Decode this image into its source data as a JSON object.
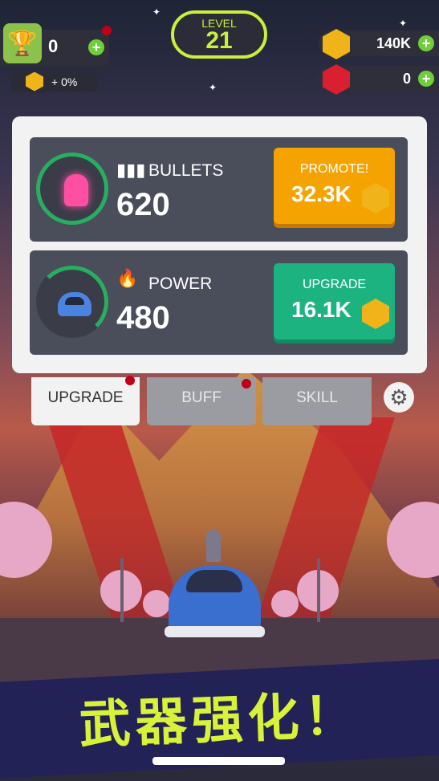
{
  "hud": {
    "trophy_count": "0",
    "bonus_text": "+ 0%",
    "level_label": "LEVEL",
    "level_number": "21",
    "gold_amount": "140K",
    "gem_amount": "0"
  },
  "upgrades": [
    {
      "icon": "bullet-icon",
      "label": "BULLETS",
      "value": "620",
      "button_label": "PROMOTE!",
      "button_price": "32.3K",
      "button_color": "#f5a300"
    },
    {
      "icon": "flame-icon",
      "label": "POWER",
      "value": "480",
      "button_label": "UPGRADE",
      "button_price": "16.1K",
      "button_color": "#1db380"
    }
  ],
  "tabs": [
    "UPGRADE",
    "BUFF",
    "SKILL"
  ],
  "banner_text": "武器强化！",
  "colors": {
    "accent": "#c8f03c",
    "gold": "#f0b41a",
    "ruby": "#d82030",
    "banner": "#232257"
  }
}
